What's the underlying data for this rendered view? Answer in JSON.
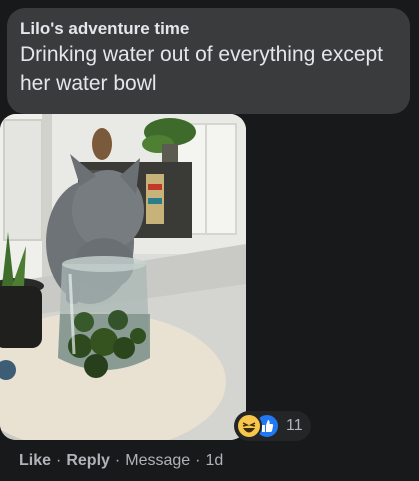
{
  "comment": {
    "author": "Lilo's adventure time",
    "text": "Drinking water out of everything except her water bowl",
    "photo_icon": "cat-drinking-from-vase-photo",
    "reactions": {
      "icons": [
        "haha-emoji-icon",
        "like-thumb-icon"
      ],
      "count": "11"
    },
    "actions": {
      "like": "Like",
      "separator": "·",
      "reply": "Reply",
      "message": "Message",
      "time": "1d"
    }
  },
  "colors": {
    "background": "#18191a",
    "bubble": "#3a3b3c",
    "primary_text": "#e4e6eb",
    "secondary_text": "#b0b3b8",
    "like_blue": "#2078f4",
    "haha_yellow": "#f7c64a"
  }
}
